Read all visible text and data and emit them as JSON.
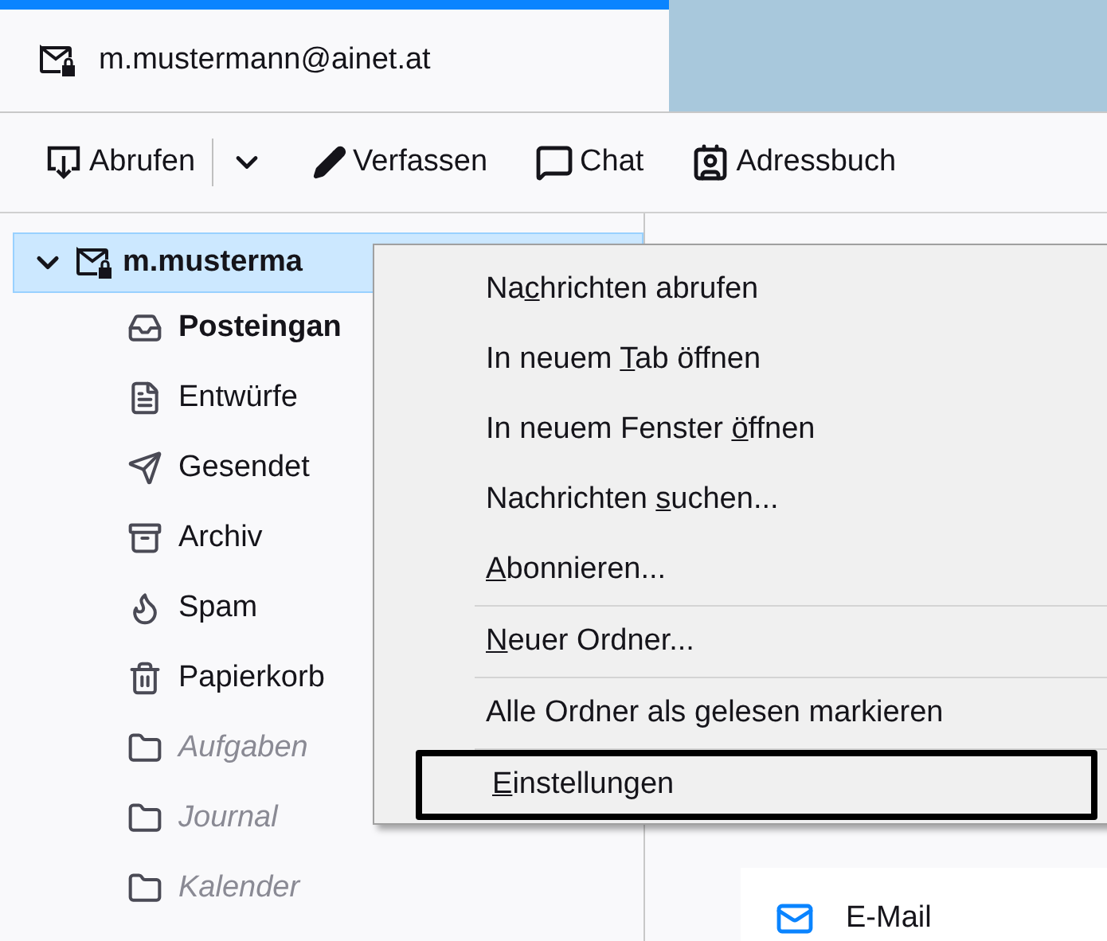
{
  "tab": {
    "title": "m.mustermann@ainet.at",
    "selected": true
  },
  "toolbar": [
    {
      "kind": "get",
      "label": "Abrufen"
    },
    {
      "kind": "dropdown"
    },
    {
      "kind": "write",
      "label": "Verfassen"
    },
    {
      "kind": "chat",
      "label": "Chat"
    },
    {
      "kind": "contacts",
      "label": "Adressbuch"
    }
  ],
  "folder_tree": {
    "account": {
      "name": "m.musterma",
      "expanded": true,
      "selected": true
    },
    "folders": [
      {
        "kind": "inbox",
        "name": "Posteingan",
        "bold": true,
        "dimmed": false
      },
      {
        "kind": "drafts",
        "name": "Entwürfe",
        "bold": false,
        "dimmed": false
      },
      {
        "kind": "sent",
        "name": "Gesendet",
        "bold": false,
        "dimmed": false
      },
      {
        "kind": "archive",
        "name": "Archiv",
        "bold": false,
        "dimmed": false
      },
      {
        "kind": "spam",
        "name": "Spam",
        "bold": false,
        "dimmed": false
      },
      {
        "kind": "trash",
        "name": "Papierkorb",
        "bold": false,
        "dimmed": false
      },
      {
        "kind": "folder",
        "name": "Aufgaben",
        "bold": false,
        "dimmed": true
      },
      {
        "kind": "folder",
        "name": "Journal",
        "bold": false,
        "dimmed": true
      },
      {
        "kind": "folder",
        "name": "Kalender",
        "bold": false,
        "dimmed": true
      }
    ]
  },
  "main_pane": {
    "link": "E-Mail"
  },
  "context_menu": [
    {
      "kind": "item",
      "before": "Na",
      "key": "c",
      "after": "hrichten abrufen",
      "highlighted": false
    },
    {
      "kind": "item",
      "before": "In neuem ",
      "key": "T",
      "after": "ab öffnen",
      "highlighted": false
    },
    {
      "kind": "item",
      "before": "In neuem Fenster ",
      "key": "ö",
      "after": "ffnen",
      "highlighted": false
    },
    {
      "kind": "item",
      "before": "Nachrichten ",
      "key": "s",
      "after": "uchen...",
      "highlighted": false
    },
    {
      "kind": "item",
      "key": "A",
      "after": "bonnieren...",
      "highlighted": false
    },
    {
      "kind": "separator"
    },
    {
      "kind": "item",
      "key": "N",
      "after": "euer Ordner...",
      "highlighted": false
    },
    {
      "kind": "separator"
    },
    {
      "kind": "item",
      "before": "Alle Ordner als gelesen markieren",
      "highlighted": false
    },
    {
      "kind": "separator"
    },
    {
      "kind": "item",
      "key": "E",
      "after": "instellungen",
      "highlighted": true
    }
  ]
}
